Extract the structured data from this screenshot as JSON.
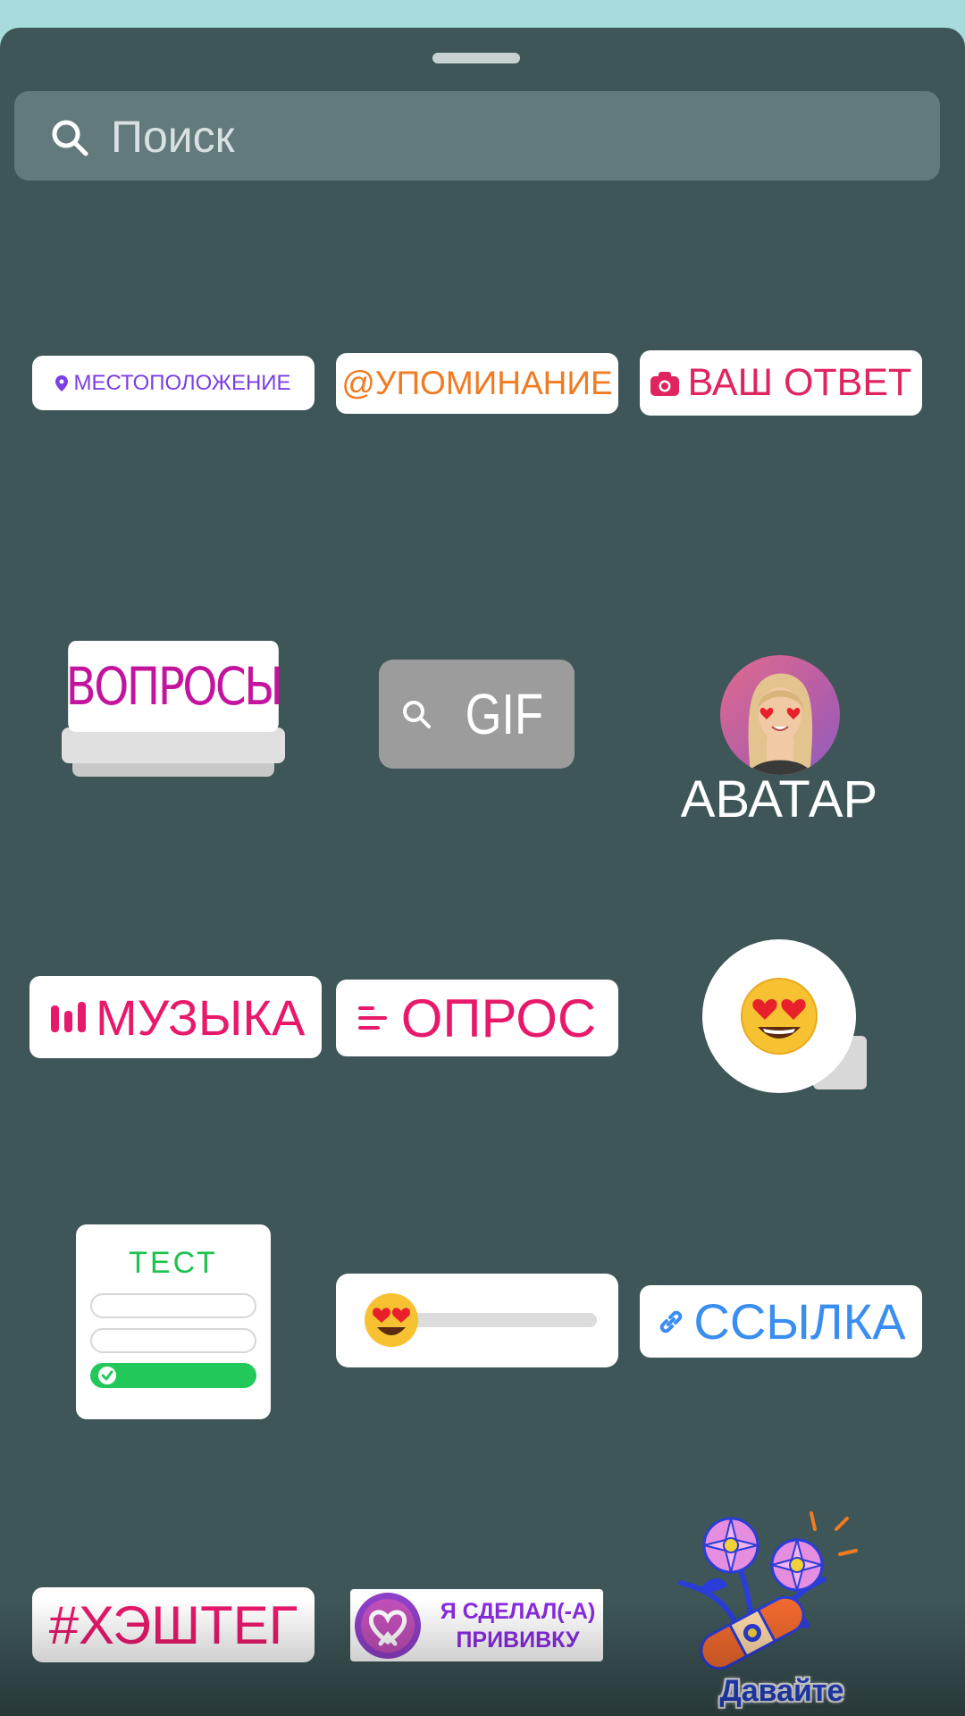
{
  "search": {
    "placeholder": "Поиск"
  },
  "stickers": {
    "location": "МЕСТОПОЛОЖЕНИЕ",
    "mention": "@УПОМИНАНИЕ",
    "your_answer": "ВАШ ОТВЕТ",
    "questions": "ВОПРОСЫ",
    "gif": "GIF",
    "avatar": "АВАТАР",
    "music": "МУЗЫКА",
    "poll": "ОПРОС",
    "quiz": "ТЕСТ",
    "link": "ССЫЛКА",
    "hashtag": "#ХЭШТЕГ",
    "vaccine": "Я СДЕЛАЛ(-А) ПРИВИВКУ",
    "vaccinate_call": "Давайте вакцинируемся"
  },
  "colors": {
    "sheet_bg": "#3e5658",
    "top_strip": "#a8dcdc",
    "location": "#7b3fe4",
    "mention": "#f07b22",
    "answer": "#e0245e",
    "questions": "#c3149d",
    "music": "#e8196b",
    "quiz": "#1ec24f",
    "link": "#3a8ef1",
    "vaccine": "#8a2be2"
  },
  "icons": {
    "search": "search-icon",
    "location": "location-pin-icon",
    "answer": "camera-icon",
    "gif": "search-icon",
    "music": "music-bars-icon",
    "poll": "poll-lines-icon",
    "emoji": "heart-eyes-emoji-icon",
    "link": "link-icon",
    "vaccine": "heart-badge-icon"
  }
}
